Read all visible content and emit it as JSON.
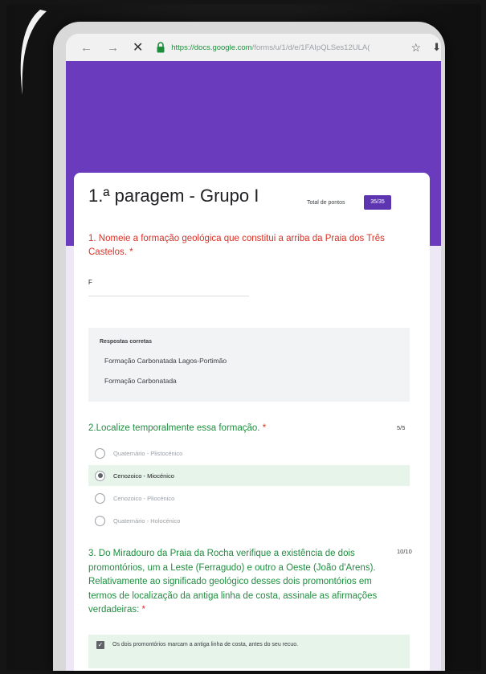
{
  "browser": {
    "url_domain": "https://docs.google.com",
    "url_path": "/forms/u/1/d/e/1FAIpQLSes12ULA(",
    "back_icon": "←",
    "forward_icon": "→",
    "close_icon": "✕",
    "star_icon": "☆",
    "download_icon": "⬇"
  },
  "form": {
    "title": "1.ª paragem - Grupo I",
    "total_label": "Total de pontos",
    "total_score": "35/35",
    "q1": {
      "text": "1. Nomeie a formação geológica que constitui a arriba da Praia dos Três Castelos. *",
      "answer": "F",
      "correct_title": "Respostas corretas",
      "correct_answers": [
        "Formação Carbonatada Lagos-Portimão",
        "Formação Carbonatada"
      ]
    },
    "q2": {
      "text": "2.Localize temporalmente essa formação.",
      "required": "*",
      "score": "5/5",
      "options": [
        "Quaternário - Plistocénico",
        "Cenozoico - Miocénico",
        "Cenozoico - Pliocénico",
        "Quaternário - Holocénico"
      ],
      "selected": 1
    },
    "q3": {
      "text": "3. Do Miradouro da Praia da Rocha verifique a existência de dois promontórios, um a Leste (Ferragudo) e outro a Oeste (João d'Arens). Relativamente ao significado geológico desses dois promontórios em termos de localização da antiga linha de costa, assinale as afirmações verdadeiras:",
      "required": "*",
      "score": "10/10",
      "check_option_1": "Os dois promontórios marcam a antiga linha de costa, antes do seu recuo."
    }
  },
  "colors": {
    "header": "#6a3bbd",
    "badge": "#5e35b1",
    "correct_green": "#1e8e3e",
    "required_red": "#d93025"
  }
}
